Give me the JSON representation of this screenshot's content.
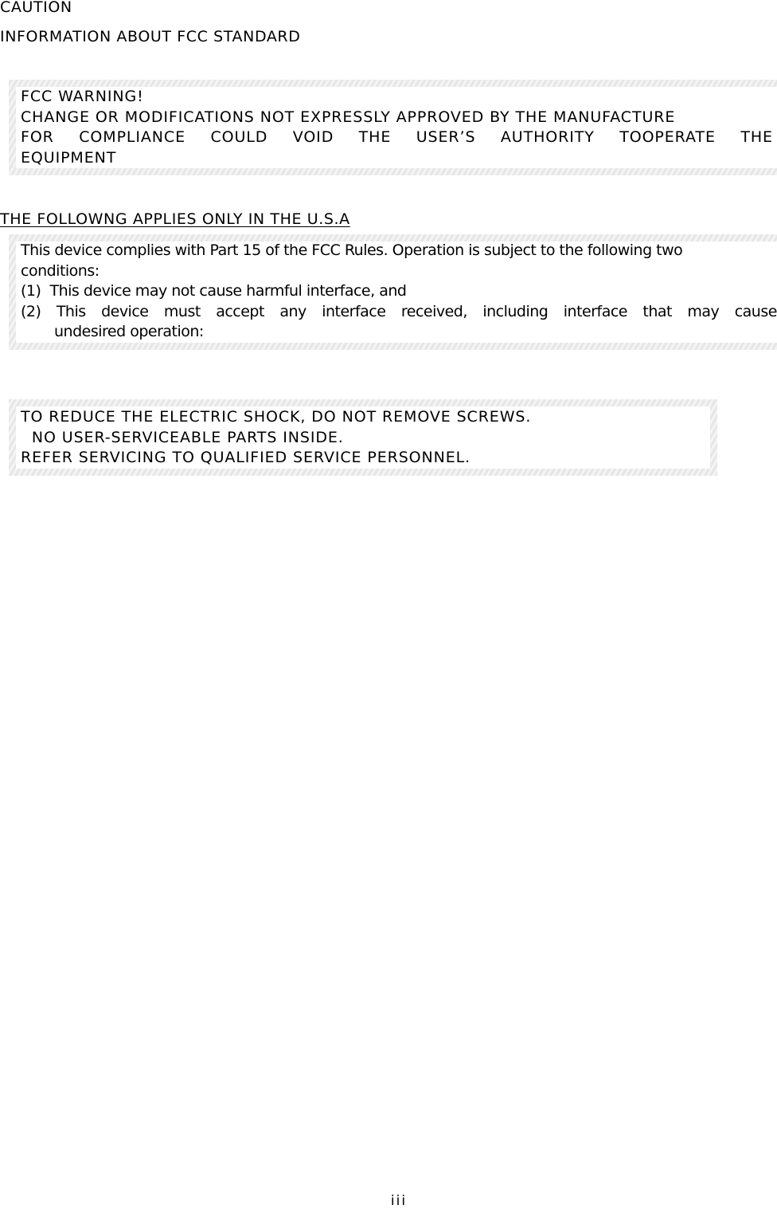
{
  "page": {
    "caution_title": "CAUTION",
    "fcc_info_title": "INFORMATION ABOUT FCC STANDARD",
    "page_number": "iii"
  },
  "fcc_warning_box": {
    "title": "FCC WARNING!",
    "line1": "CHANGE OR MODIFICATIONS NOT EXPRESSLY APPROVED BY THE MANUFACTURE",
    "line2_words": [
      "FOR",
      "COMPLIANCE",
      "COULD",
      "VOID",
      "THE",
      "USER'S",
      "AUTHORITY",
      "TOOPERATE",
      "THE"
    ],
    "line3": "EQUIPMENT"
  },
  "usa_section": {
    "heading": "THE FOLLOWNG APPLIES ONLY IN THE U.S.A",
    "line1": "This device complies with Part 15 of the FCC Rules. Operation is subject to the following two",
    "line2": "conditions:",
    "item1": "(1)  This device may not cause harmful interface, and",
    "item2_words": [
      "(2)",
      "This",
      "device",
      "must",
      "accept",
      "any",
      "interface",
      "received,",
      "including",
      "interface",
      "that",
      "may",
      "cause"
    ],
    "item2_cont": "undesired operation:"
  },
  "shock_box": {
    "line1": "TO REDUCE THE ELECTRIC SHOCK, DO NOT REMOVE SCREWS.",
    "line2": "  NO USER-SERVICEABLE PARTS INSIDE.",
    "line3": "REFER SERVICING TO QUALIFIED SERVICE PERSONNEL."
  }
}
